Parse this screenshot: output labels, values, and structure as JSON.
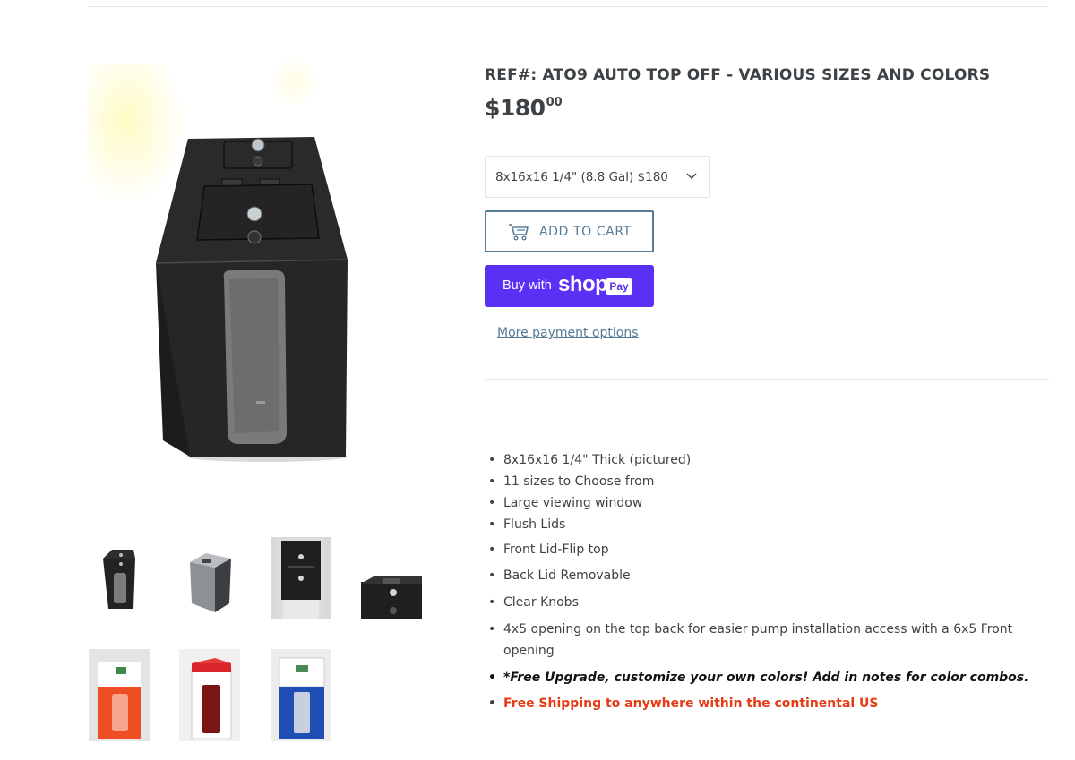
{
  "product": {
    "title": "REF#: ATO9 AUTO TOP OFF - VARIOUS SIZES AND COLORS",
    "price_main": "$180",
    "price_cents": "00",
    "variant_selected": "8x16x16 1/4\" (8.8 Gal) $180",
    "add_to_cart": "ADD TO CART",
    "buy_with": "Buy with",
    "shop_word": "shop",
    "pay_word": "Pay",
    "more_payment": "More payment options"
  },
  "features": [
    {
      "text": "8x16x16 1/4\" Thick (pictured)",
      "style": "normal"
    },
    {
      "text": "11 sizes to Choose from",
      "style": "normal"
    },
    {
      "text": "Large viewing window",
      "style": "normal"
    },
    {
      "text": "Flush Lids",
      "style": "normal"
    },
    {
      "text": "Front Lid-Flip top",
      "style": "normal"
    },
    {
      "text": "Back Lid Removable",
      "style": "normal"
    },
    {
      "text": "Clear Knobs",
      "style": "normal"
    },
    {
      "text": "4x5 opening on the top back for easier pump installation access with a 6x5 Front opening",
      "style": "normal"
    },
    {
      "text": "*Free Upgrade, customize your own colors! Add in notes for color combos.",
      "style": "bold"
    },
    {
      "text": "Free Shipping to anywhere within the continental US",
      "style": "red"
    }
  ],
  "colors": {
    "accent": "#557b97",
    "shop_pay": "#5a31f4",
    "highlight_red": "#e63b15",
    "text": "#3d4246"
  },
  "icons": {
    "cart": "cart-icon",
    "select_chevron": "chevron-down-icon"
  }
}
